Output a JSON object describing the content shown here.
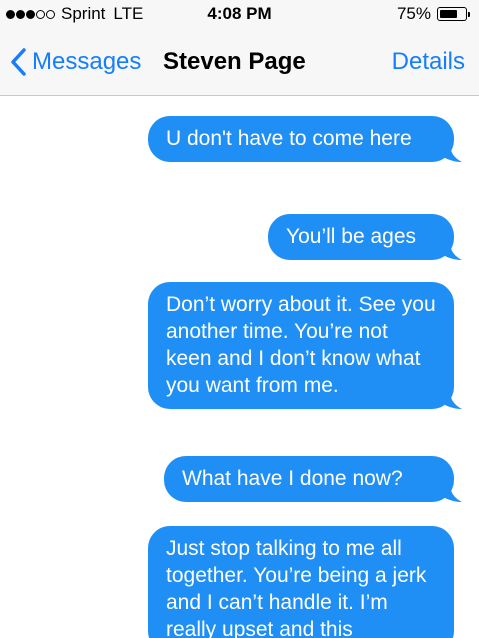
{
  "status_bar": {
    "signal_filled": 3,
    "signal_total": 5,
    "carrier": "Sprint",
    "network": "LTE",
    "time": "4:08 PM",
    "battery_percent": "75%",
    "battery_level": 0.75
  },
  "nav": {
    "back_label": "Messages",
    "back_icon": "chevron-left-icon",
    "title": "Steven Page",
    "details_label": "Details"
  },
  "colors": {
    "accent": "#147efb",
    "bubble": "#1f8ff5",
    "bubble_text": "#ffffff",
    "bar_background": "#f7f7f7"
  },
  "messages": [
    {
      "text": "U don't have to come here",
      "sender": "me"
    },
    {
      "text": "You’ll be ages",
      "sender": "me"
    },
    {
      "text": "Don’t worry about it. See you another time. You’re not keen and I don’t know what you want from me.",
      "sender": "me"
    },
    {
      "text": "What have I done now?",
      "sender": "me"
    },
    {
      "text": "Just stop talking to me all together. You’re being a jerk and I can’t handle it. I’m really upset and this",
      "sender": "me"
    }
  ]
}
